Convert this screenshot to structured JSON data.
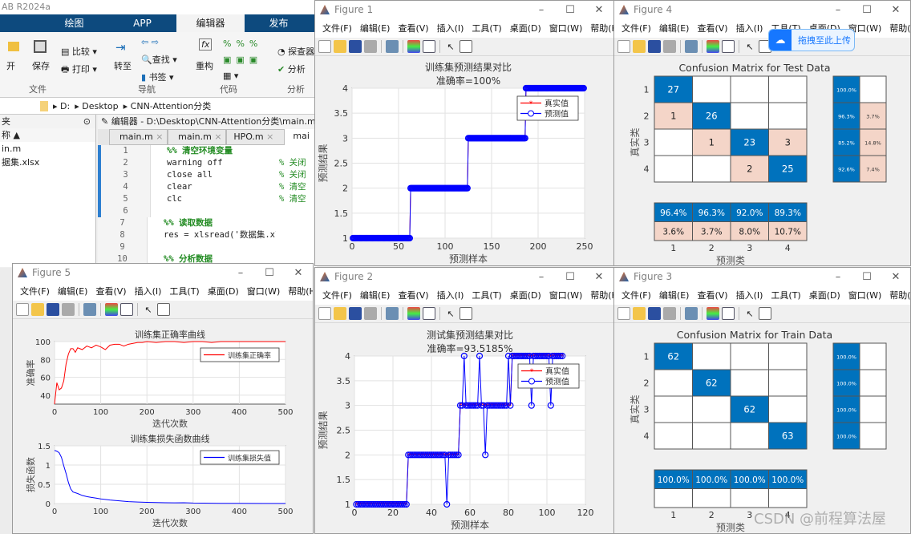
{
  "menu": [
    "文件(F)",
    "编辑(E)",
    "查看(V)",
    "插入(I)",
    "工具(T)",
    "桌面(D)",
    "窗口(W)",
    "帮助(H)"
  ],
  "toolbar_icons": [
    "new-file-icon",
    "open-folder-icon",
    "save-icon",
    "print-icon",
    "link-plot-icon",
    "colorbar-icon",
    "legend-icon",
    "pointer-icon",
    "property-editor-icon"
  ],
  "matlab": {
    "app_title": "AB R2024a",
    "tabs": [
      "绘图",
      "APP",
      "编辑器",
      "发布"
    ],
    "selected_tab": "编辑器",
    "toolstrip": {
      "open": "开",
      "save": "保存",
      "compare": "比较",
      "print": "打印",
      "goto": "转至",
      "find": "查找",
      "bookmark": "书签",
      "refactor": "重构",
      "profiler": "探查器",
      "analyze": "分析",
      "groups": [
        "文件",
        "导航",
        "代码",
        "分析"
      ]
    },
    "path": [
      "D:",
      "Desktop",
      "CNN-Attention分类"
    ],
    "file_panel": {
      "header": "夹",
      "column": "称 ▲",
      "files": [
        "in.m",
        "据集.xlsx"
      ]
    },
    "editor_title": "编辑器 - D:\\Desktop\\CNN-Attention分类\\main.m",
    "editor_tabs": [
      "main.m",
      "main.m",
      "HPO.m",
      "mai"
    ],
    "code": [
      {
        "n": "1",
        "code": "%%  清空环境变量",
        "comment": ""
      },
      {
        "n": "2",
        "code": "warning off",
        "comment": "% 关闭"
      },
      {
        "n": "3",
        "code": "close all",
        "comment": "% 关闭"
      },
      {
        "n": "4",
        "code": "clear",
        "comment": "% 清空"
      },
      {
        "n": "5",
        "code": "clc",
        "comment": "% 清空"
      },
      {
        "n": "6",
        "code": "",
        "comment": ""
      },
      {
        "n": "7",
        "code": "%%  读取数据",
        "comment": ""
      },
      {
        "n": "8",
        "code": "res = xlsread('数据集.xlsx');",
        "comment": ""
      },
      {
        "n": "9",
        "code": "",
        "comment": ""
      },
      {
        "n": "10",
        "code": "%%  分析数据",
        "comment": ""
      }
    ]
  },
  "upload_badge": "拖拽至此上传",
  "watermark": "CSDN @前程算法屋",
  "colors": {
    "true_series": "#ff0000",
    "pred_series": "#0000ff",
    "cm_diag": "#0072bd",
    "cm_off": "#f4d5c8",
    "tab_bar": "#0d4a7e"
  },
  "figures": {
    "fig1": {
      "title": "Figure 1"
    },
    "fig2": {
      "title": "Figure 2"
    },
    "fig3": {
      "title": "Figure 3"
    },
    "fig4": {
      "title": "Figure 4"
    },
    "fig5": {
      "title": "Figure 5"
    }
  },
  "chart_data": [
    {
      "id": "fig1",
      "type": "line",
      "title": [
        "训练集预测结果对比",
        "准确率=100%"
      ],
      "xlabel": "预测样本",
      "ylabel": "预测结果",
      "xlim": [
        0,
        250
      ],
      "ylim": [
        1,
        4
      ],
      "xticks": [
        0,
        50,
        100,
        150,
        200,
        250
      ],
      "yticks": [
        1,
        1.5,
        2,
        2.5,
        3,
        3.5,
        4
      ],
      "grid": true,
      "legend": "top-right",
      "series": [
        {
          "name": "真实值",
          "marker": "*",
          "runs": [
            {
              "value": 1,
              "count": 62
            },
            {
              "value": 2,
              "count": 62
            },
            {
              "value": 3,
              "count": 62
            },
            {
              "value": 4,
              "count": 63
            }
          ]
        },
        {
          "name": "预测值",
          "marker": "o",
          "runs": [
            {
              "value": 1,
              "count": 62
            },
            {
              "value": 2,
              "count": 62
            },
            {
              "value": 3,
              "count": 62
            },
            {
              "value": 4,
              "count": 63
            }
          ]
        }
      ]
    },
    {
      "id": "fig2",
      "type": "line",
      "title": [
        "测试集预测结果对比",
        "准确率=93.5185%"
      ],
      "xlabel": "预测样本",
      "ylabel": "预测结果",
      "xlim": [
        0,
        120
      ],
      "ylim": [
        1,
        4
      ],
      "xticks": [
        0,
        20,
        40,
        60,
        80,
        100,
        120
      ],
      "yticks": [
        1,
        1.5,
        2,
        2.5,
        3,
        3.5,
        4
      ],
      "grid": true,
      "legend": "top-right",
      "series": [
        {
          "name": "真实值",
          "marker": "*",
          "y": [
            1,
            1,
            1,
            1,
            1,
            1,
            1,
            1,
            1,
            1,
            1,
            1,
            1,
            1,
            1,
            1,
            1,
            1,
            1,
            1,
            1,
            1,
            1,
            1,
            1,
            1,
            1,
            2,
            2,
            2,
            2,
            2,
            2,
            2,
            2,
            2,
            2,
            2,
            2,
            2,
            2,
            2,
            2,
            2,
            2,
            2,
            2,
            2,
            2,
            2,
            2,
            2,
            2,
            2,
            3,
            3,
            3,
            3,
            3,
            3,
            3,
            3,
            3,
            3,
            3,
            3,
            3,
            3,
            3,
            3,
            3,
            3,
            3,
            3,
            3,
            3,
            3,
            3,
            3,
            3,
            3,
            4,
            4,
            4,
            4,
            4,
            4,
            4,
            4,
            4,
            4,
            4,
            4,
            4,
            4,
            4,
            4,
            4,
            4,
            4,
            4,
            4,
            4,
            4,
            4,
            4,
            4,
            4
          ]
        },
        {
          "name": "预测值",
          "marker": "o",
          "y": [
            1,
            1,
            1,
            1,
            1,
            1,
            1,
            1,
            1,
            1,
            1,
            1,
            1,
            1,
            1,
            1,
            1,
            1,
            1,
            1,
            1,
            1,
            1,
            1,
            1,
            1,
            1,
            2,
            2,
            2,
            2,
            2,
            2,
            2,
            2,
            2,
            2,
            2,
            2,
            2,
            2,
            2,
            2,
            2,
            2,
            2,
            2,
            1,
            2,
            2,
            2,
            2,
            2,
            2,
            3,
            3,
            4,
            3,
            3,
            3,
            3,
            3,
            3,
            3,
            4,
            3,
            3,
            2,
            3,
            3,
            3,
            3,
            3,
            3,
            3,
            3,
            3,
            3,
            3,
            4,
            3,
            4,
            4,
            4,
            4,
            4,
            4,
            4,
            4,
            4,
            4,
            3,
            4,
            4,
            4,
            4,
            4,
            4,
            4,
            4,
            4,
            3,
            4,
            4,
            4,
            4,
            4,
            4
          ]
        }
      ]
    },
    {
      "id": "fig5a",
      "type": "line",
      "title": [
        "训练集正确率曲线"
      ],
      "xlabel": "迭代次数",
      "ylabel": "准确率",
      "xlim": [
        0,
        500
      ],
      "ylim": [
        30,
        100
      ],
      "xticks": [
        0,
        100,
        200,
        300,
        400,
        500
      ],
      "yticks": [
        40,
        60,
        80,
        100
      ],
      "grid": true,
      "legend": "top-right",
      "series": [
        {
          "name": "训练集正确率",
          "marker": "",
          "x": [
            0,
            5,
            10,
            15,
            20,
            25,
            30,
            35,
            40,
            45,
            50,
            60,
            70,
            80,
            90,
            100,
            110,
            120,
            130,
            140,
            150,
            160,
            170,
            180,
            190,
            200,
            220,
            240,
            260,
            280,
            300,
            320,
            340,
            360,
            380,
            400,
            420,
            440,
            460,
            480,
            500
          ],
          "y": [
            30,
            54,
            46,
            48,
            56,
            75,
            86,
            92,
            92,
            88,
            93,
            91,
            95,
            93,
            96,
            94,
            91,
            96,
            97,
            97,
            95,
            97,
            98,
            99,
            99,
            100,
            99,
            100,
            100,
            99,
            100,
            100,
            99,
            100,
            100,
            100,
            100,
            100,
            100,
            100,
            100
          ]
        }
      ]
    },
    {
      "id": "fig5b",
      "type": "line",
      "title": [
        "训练集损失函数曲线"
      ],
      "xlabel": "迭代次数",
      "ylabel": "损失函数",
      "xlim": [
        0,
        500
      ],
      "ylim": [
        0,
        1.5
      ],
      "xticks": [
        0,
        100,
        200,
        300,
        400,
        500
      ],
      "yticks": [
        0,
        0.5,
        1,
        1.5
      ],
      "grid": true,
      "legend": "top-right",
      "series": [
        {
          "name": "训练集损失值",
          "marker": "",
          "x": [
            0,
            5,
            10,
            15,
            20,
            25,
            30,
            35,
            40,
            50,
            60,
            70,
            80,
            90,
            100,
            120,
            140,
            160,
            180,
            200,
            220,
            240,
            260,
            280,
            300,
            320,
            340,
            360,
            380,
            400,
            450,
            500
          ],
          "y": [
            1.38,
            1.36,
            1.32,
            1.2,
            0.98,
            0.78,
            0.55,
            0.38,
            0.3,
            0.26,
            0.21,
            0.18,
            0.16,
            0.14,
            0.12,
            0.09,
            0.07,
            0.05,
            0.04,
            0.03,
            0.025,
            0.02,
            0.018,
            0.02,
            0.012,
            0.01,
            0.008,
            0.006,
            0.005,
            0.004,
            0.003,
            0.002
          ]
        }
      ]
    },
    {
      "id": "fig4",
      "type": "heatmap",
      "title": "Confusion Matrix for Test Data",
      "xlabel": "预测类",
      "ylabel": "真实类",
      "classes": [
        "1",
        "2",
        "3",
        "4"
      ],
      "matrix": [
        [
          27,
          0,
          0,
          0
        ],
        [
          1,
          26,
          0,
          0
        ],
        [
          0,
          1,
          23,
          3
        ],
        [
          0,
          0,
          2,
          25
        ]
      ],
      "row_summary": [
        [
          "100.0%",
          ""
        ],
        [
          "96.3%",
          "3.7%"
        ],
        [
          "85.2%",
          "14.8%"
        ],
        [
          "92.6%",
          "7.4%"
        ]
      ],
      "col_summary": [
        [
          "96.4%",
          "96.3%",
          "92.0%",
          "89.3%"
        ],
        [
          "3.6%",
          "3.7%",
          "8.0%",
          "10.7%"
        ]
      ]
    },
    {
      "id": "fig3",
      "type": "heatmap",
      "title": "Confusion Matrix for Train Data",
      "xlabel": "预测类",
      "ylabel": "真实类",
      "classes": [
        "1",
        "2",
        "3",
        "4"
      ],
      "matrix": [
        [
          62,
          0,
          0,
          0
        ],
        [
          0,
          62,
          0,
          0
        ],
        [
          0,
          0,
          62,
          0
        ],
        [
          0,
          0,
          0,
          63
        ]
      ],
      "row_summary": [
        [
          "100.0%",
          ""
        ],
        [
          "100.0%",
          ""
        ],
        [
          "100.0%",
          ""
        ],
        [
          "100.0%",
          ""
        ]
      ],
      "col_summary": [
        [
          "100.0%",
          "100.0%",
          "100.0%",
          "100.0%"
        ],
        [
          "",
          "",
          "",
          ""
        ]
      ]
    }
  ]
}
